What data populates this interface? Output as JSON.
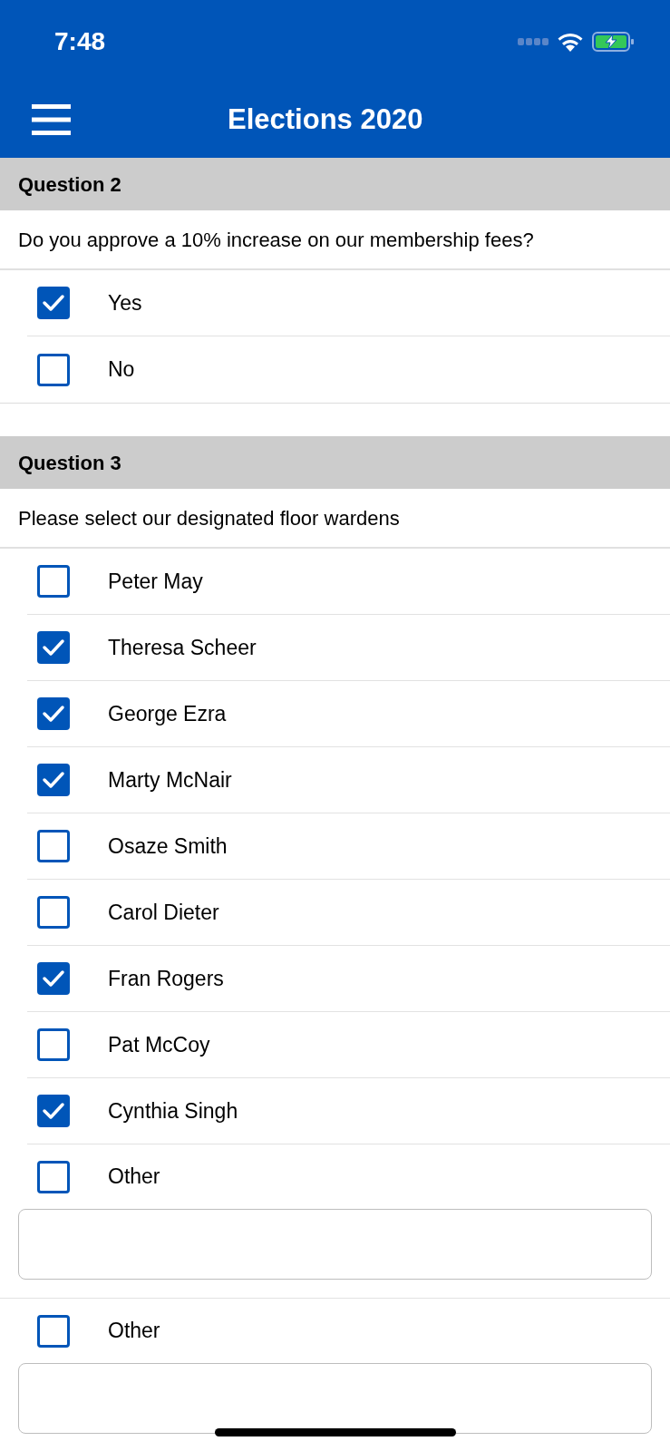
{
  "status_bar": {
    "time": "7:48",
    "charging": true
  },
  "nav_bar": {
    "title": "Elections 2020"
  },
  "questions": [
    {
      "heading": "Question 2",
      "prompt": "Do you approve a 10% increase on our membership fees?",
      "options": [
        {
          "kind": "checkbox",
          "label": "Yes",
          "checked": true
        },
        {
          "kind": "checkbox",
          "label": "No",
          "checked": false
        }
      ]
    },
    {
      "heading": "Question 3",
      "prompt": "Please select our designated floor wardens",
      "options": [
        {
          "kind": "checkbox",
          "label": "Peter May",
          "checked": false
        },
        {
          "kind": "checkbox",
          "label": "Theresa Scheer",
          "checked": true
        },
        {
          "kind": "checkbox",
          "label": "George Ezra",
          "checked": true
        },
        {
          "kind": "checkbox",
          "label": "Marty McNair",
          "checked": true
        },
        {
          "kind": "checkbox",
          "label": "Osaze Smith",
          "checked": false
        },
        {
          "kind": "checkbox",
          "label": "Carol Dieter",
          "checked": false
        },
        {
          "kind": "checkbox",
          "label": "Fran Rogers",
          "checked": true
        },
        {
          "kind": "checkbox",
          "label": "Pat McCoy",
          "checked": false
        },
        {
          "kind": "checkbox",
          "label": "Cynthia Singh",
          "checked": true
        },
        {
          "kind": "other",
          "label": "Other",
          "checked": false
        },
        {
          "kind": "other",
          "label": "Other",
          "checked": false
        }
      ]
    }
  ]
}
